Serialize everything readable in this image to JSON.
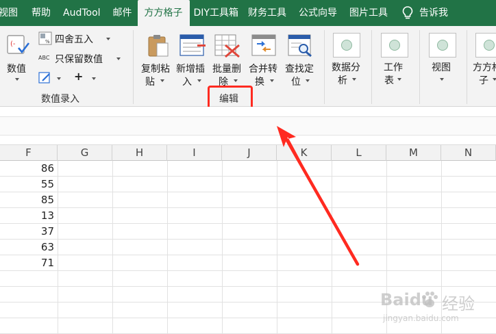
{
  "tabs": [
    {
      "label": "视图"
    },
    {
      "label": "帮助"
    },
    {
      "label": "AudTool"
    },
    {
      "label": "邮件"
    },
    {
      "label": "方方格子",
      "active": true
    },
    {
      "label": "DIY工具箱"
    },
    {
      "label": "财务工具"
    },
    {
      "label": "公式向导"
    },
    {
      "label": "图片工具"
    }
  ],
  "tell_me": "告诉我",
  "ribbon": {
    "numeric_group": {
      "value_button": {
        "line1": "数值",
        "icon": "numeric-value-icon"
      },
      "round_button": {
        "label": "四舍五入"
      },
      "keep_value_button": {
        "label": "只保留数值"
      },
      "plus_label": "+",
      "group_label": "数值录入"
    },
    "edit_group": {
      "copy_paste": {
        "line1": "复制粘",
        "line2": "贴"
      },
      "insert": {
        "line1": "新增插",
        "line2": "入"
      },
      "batch_delete": {
        "line1": "批量删",
        "line2": "除"
      },
      "merge_convert": {
        "line1": "合并转",
        "line2": "换"
      },
      "find_locate": {
        "line1": "查找定",
        "line2": "位"
      },
      "group_label": "编辑"
    },
    "data_analysis": {
      "line1": "数据分",
      "line2": "析"
    },
    "worksheet": {
      "line1": "工作",
      "line2": "表"
    },
    "view": {
      "line1": "视图"
    },
    "box": {
      "line1": "方方格",
      "line2": "子"
    }
  },
  "grid": {
    "columns": [
      "F",
      "G",
      "H",
      "I",
      "J",
      "K",
      "L",
      "M",
      "N"
    ],
    "column_f_values": [
      "86",
      "55",
      "85",
      "13",
      "37",
      "63",
      "71"
    ]
  },
  "watermark": {
    "brand": "Baidu",
    "suffix": "经验",
    "url": "jingyan.baidu.com"
  },
  "colors": {
    "accent": "#217346",
    "annotation": "#ff2a20"
  }
}
